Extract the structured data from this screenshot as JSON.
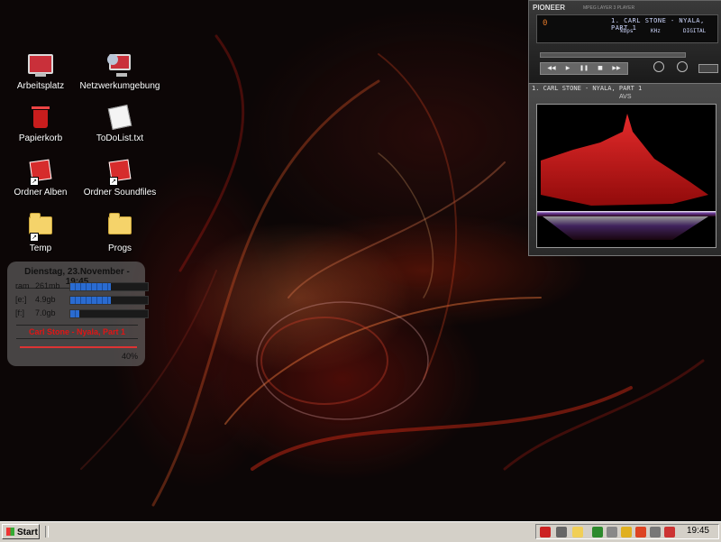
{
  "desktop": {
    "icons": [
      {
        "label": "Arbeitsplatz",
        "icon": "my-computer-icon"
      },
      {
        "label": "Netzwerkumgebung",
        "icon": "network-icon"
      },
      {
        "label": "Papierkorb",
        "icon": "recycle-bin-icon"
      },
      {
        "label": "ToDoList.txt",
        "icon": "text-file-icon"
      },
      {
        "label": "Ordner Alben",
        "icon": "folder-shortcut-icon"
      },
      {
        "label": "Ordner Soundfiles",
        "icon": "folder-shortcut-icon"
      },
      {
        "label": "Temp",
        "icon": "folder-icon"
      },
      {
        "label": "Progs",
        "icon": "folder-icon"
      }
    ]
  },
  "widget": {
    "date": "Dienstag, 23.November - 19:45",
    "rows": [
      {
        "key": "ram",
        "value": "261mb",
        "fill": 0.52
      },
      {
        "key": "[e:]",
        "value": "4.9gb",
        "fill": 0.52
      },
      {
        "key": "[f:]",
        "value": "7.0gb",
        "fill": 0.12
      }
    ],
    "song": "Carl Stone - Nyala, Part 1",
    "progress_label": "40%",
    "progress": 0.4
  },
  "player": {
    "brand": "PIONEER",
    "subtitle": "MPEG LAYER 3 PLAYER",
    "track_title": "1. CARL STONE - NYALA, PART 1",
    "kbps_label": "kbps",
    "khz_label": "KHz",
    "digital_label": "DIGITAL",
    "time": "0",
    "buttons": [
      "prev-icon",
      "play-icon",
      "pause-icon",
      "stop-icon",
      "next-icon"
    ]
  },
  "avs": {
    "titlebar": "1. CARL STONE - NYALA, PART 1",
    "name": "AVS"
  },
  "taskbar": {
    "start_label": "Start",
    "clock": "19:45",
    "accent": "#d4d0c8"
  }
}
